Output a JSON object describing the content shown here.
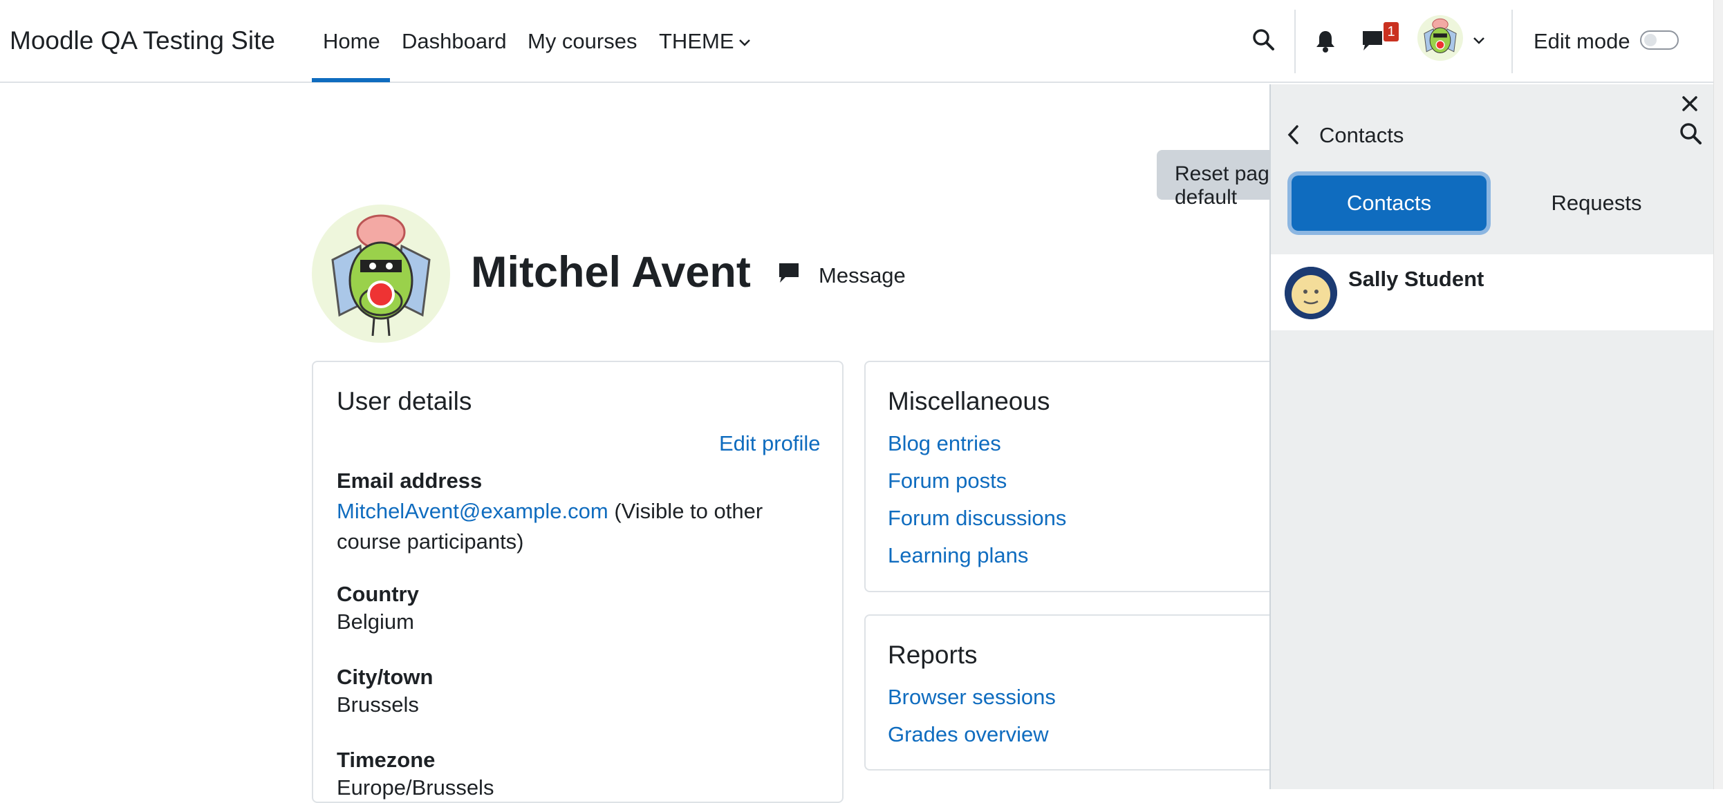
{
  "navbar": {
    "brand": "Moodle QA Testing Site",
    "links": [
      "Home",
      "Dashboard",
      "My courses",
      "THEME"
    ],
    "message_badge": "1",
    "edit_mode_label": "Edit mode"
  },
  "page": {
    "reset_button": "Reset page to default",
    "user_name": "Mitchel Avent",
    "message_button": "Message"
  },
  "user_details": {
    "title": "User details",
    "edit_profile": "Edit profile",
    "email_label": "Email address",
    "email_value": "MitchelAvent@example.com",
    "email_visibility_line1": " (Visible to other",
    "email_visibility_line2": "course participants)",
    "country_label": "Country",
    "country_value": "Belgium",
    "city_label": "City/town",
    "city_value": "Brussels",
    "timezone_label": "Timezone",
    "timezone_value": "Europe/Brussels"
  },
  "misc": {
    "title": "Miscellaneous",
    "links": [
      "Blog entries",
      "Forum posts",
      "Forum discussions",
      "Learning plans"
    ]
  },
  "reports": {
    "title": "Reports",
    "links": [
      "Browser sessions",
      "Grades overview"
    ]
  },
  "drawer": {
    "title": "Contacts",
    "tabs": [
      "Contacts",
      "Requests"
    ],
    "contacts": [
      {
        "name": "Sally Student"
      }
    ]
  },
  "colors": {
    "accent": "#0f6cbf",
    "badge": "#ca3120",
    "drawer_bg": "#eceeef"
  }
}
